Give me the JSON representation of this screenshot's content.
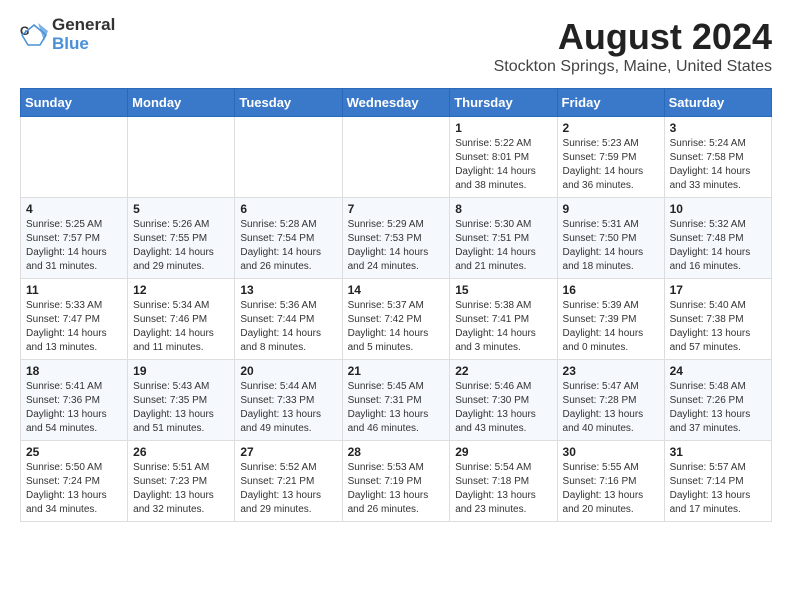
{
  "logo": {
    "line1": "General",
    "line2": "Blue"
  },
  "title": "August 2024",
  "location": "Stockton Springs, Maine, United States",
  "weekdays": [
    "Sunday",
    "Monday",
    "Tuesday",
    "Wednesday",
    "Thursday",
    "Friday",
    "Saturday"
  ],
  "weeks": [
    [
      {
        "day": "",
        "info": ""
      },
      {
        "day": "",
        "info": ""
      },
      {
        "day": "",
        "info": ""
      },
      {
        "day": "",
        "info": ""
      },
      {
        "day": "1",
        "info": "Sunrise: 5:22 AM\nSunset: 8:01 PM\nDaylight: 14 hours\nand 38 minutes."
      },
      {
        "day": "2",
        "info": "Sunrise: 5:23 AM\nSunset: 7:59 PM\nDaylight: 14 hours\nand 36 minutes."
      },
      {
        "day": "3",
        "info": "Sunrise: 5:24 AM\nSunset: 7:58 PM\nDaylight: 14 hours\nand 33 minutes."
      }
    ],
    [
      {
        "day": "4",
        "info": "Sunrise: 5:25 AM\nSunset: 7:57 PM\nDaylight: 14 hours\nand 31 minutes."
      },
      {
        "day": "5",
        "info": "Sunrise: 5:26 AM\nSunset: 7:55 PM\nDaylight: 14 hours\nand 29 minutes."
      },
      {
        "day": "6",
        "info": "Sunrise: 5:28 AM\nSunset: 7:54 PM\nDaylight: 14 hours\nand 26 minutes."
      },
      {
        "day": "7",
        "info": "Sunrise: 5:29 AM\nSunset: 7:53 PM\nDaylight: 14 hours\nand 24 minutes."
      },
      {
        "day": "8",
        "info": "Sunrise: 5:30 AM\nSunset: 7:51 PM\nDaylight: 14 hours\nand 21 minutes."
      },
      {
        "day": "9",
        "info": "Sunrise: 5:31 AM\nSunset: 7:50 PM\nDaylight: 14 hours\nand 18 minutes."
      },
      {
        "day": "10",
        "info": "Sunrise: 5:32 AM\nSunset: 7:48 PM\nDaylight: 14 hours\nand 16 minutes."
      }
    ],
    [
      {
        "day": "11",
        "info": "Sunrise: 5:33 AM\nSunset: 7:47 PM\nDaylight: 14 hours\nand 13 minutes."
      },
      {
        "day": "12",
        "info": "Sunrise: 5:34 AM\nSunset: 7:46 PM\nDaylight: 14 hours\nand 11 minutes."
      },
      {
        "day": "13",
        "info": "Sunrise: 5:36 AM\nSunset: 7:44 PM\nDaylight: 14 hours\nand 8 minutes."
      },
      {
        "day": "14",
        "info": "Sunrise: 5:37 AM\nSunset: 7:42 PM\nDaylight: 14 hours\nand 5 minutes."
      },
      {
        "day": "15",
        "info": "Sunrise: 5:38 AM\nSunset: 7:41 PM\nDaylight: 14 hours\nand 3 minutes."
      },
      {
        "day": "16",
        "info": "Sunrise: 5:39 AM\nSunset: 7:39 PM\nDaylight: 14 hours\nand 0 minutes."
      },
      {
        "day": "17",
        "info": "Sunrise: 5:40 AM\nSunset: 7:38 PM\nDaylight: 13 hours\nand 57 minutes."
      }
    ],
    [
      {
        "day": "18",
        "info": "Sunrise: 5:41 AM\nSunset: 7:36 PM\nDaylight: 13 hours\nand 54 minutes."
      },
      {
        "day": "19",
        "info": "Sunrise: 5:43 AM\nSunset: 7:35 PM\nDaylight: 13 hours\nand 51 minutes."
      },
      {
        "day": "20",
        "info": "Sunrise: 5:44 AM\nSunset: 7:33 PM\nDaylight: 13 hours\nand 49 minutes."
      },
      {
        "day": "21",
        "info": "Sunrise: 5:45 AM\nSunset: 7:31 PM\nDaylight: 13 hours\nand 46 minutes."
      },
      {
        "day": "22",
        "info": "Sunrise: 5:46 AM\nSunset: 7:30 PM\nDaylight: 13 hours\nand 43 minutes."
      },
      {
        "day": "23",
        "info": "Sunrise: 5:47 AM\nSunset: 7:28 PM\nDaylight: 13 hours\nand 40 minutes."
      },
      {
        "day": "24",
        "info": "Sunrise: 5:48 AM\nSunset: 7:26 PM\nDaylight: 13 hours\nand 37 minutes."
      }
    ],
    [
      {
        "day": "25",
        "info": "Sunrise: 5:50 AM\nSunset: 7:24 PM\nDaylight: 13 hours\nand 34 minutes."
      },
      {
        "day": "26",
        "info": "Sunrise: 5:51 AM\nSunset: 7:23 PM\nDaylight: 13 hours\nand 32 minutes."
      },
      {
        "day": "27",
        "info": "Sunrise: 5:52 AM\nSunset: 7:21 PM\nDaylight: 13 hours\nand 29 minutes."
      },
      {
        "day": "28",
        "info": "Sunrise: 5:53 AM\nSunset: 7:19 PM\nDaylight: 13 hours\nand 26 minutes."
      },
      {
        "day": "29",
        "info": "Sunrise: 5:54 AM\nSunset: 7:18 PM\nDaylight: 13 hours\nand 23 minutes."
      },
      {
        "day": "30",
        "info": "Sunrise: 5:55 AM\nSunset: 7:16 PM\nDaylight: 13 hours\nand 20 minutes."
      },
      {
        "day": "31",
        "info": "Sunrise: 5:57 AM\nSunset: 7:14 PM\nDaylight: 13 hours\nand 17 minutes."
      }
    ]
  ]
}
